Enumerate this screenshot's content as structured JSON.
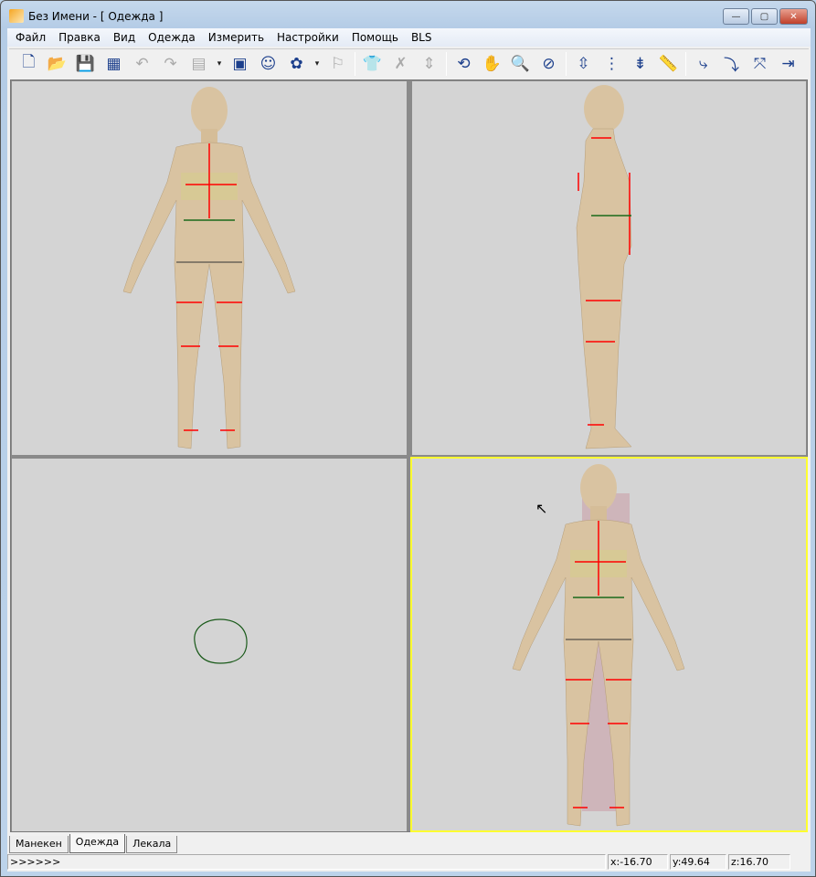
{
  "window": {
    "title": "Без Имени  - [  Одежда  ]",
    "minimize": "—",
    "maximize": "▢",
    "close": "✕"
  },
  "menu": [
    "Файл",
    "Правка",
    "Вид",
    "Одежда",
    "Измерить",
    "Настройки",
    "Помощь",
    "BLS"
  ],
  "toolbar": [
    {
      "name": "new-file-icon",
      "glyph": "🗋"
    },
    {
      "name": "open-folder-icon",
      "glyph": "📂"
    },
    {
      "name": "save-icon",
      "glyph": "💾"
    },
    {
      "name": "save-as-icon",
      "glyph": "▦"
    },
    {
      "name": "undo-icon",
      "glyph": "↶",
      "disabled": true
    },
    {
      "name": "redo-icon",
      "glyph": "↷",
      "disabled": true
    },
    {
      "name": "fabric-icon",
      "glyph": "▤",
      "disabled": true
    },
    {
      "name": "fabric-dropdown-icon",
      "glyph": "▾",
      "disabled": true,
      "small": true
    },
    {
      "name": "layout-icon",
      "glyph": "▣"
    },
    {
      "name": "mannequin-icon",
      "glyph": "☺"
    },
    {
      "name": "texture-icon",
      "glyph": "✿"
    },
    {
      "name": "texture-dropdown-icon",
      "glyph": "▾",
      "small": true
    },
    {
      "name": "flag-icon",
      "glyph": "⚐",
      "disabled": true
    },
    {
      "sep": true
    },
    {
      "name": "shirt-icon",
      "glyph": "👕"
    },
    {
      "name": "remove-garment-icon",
      "glyph": "✗",
      "disabled": true
    },
    {
      "name": "garment-size-icon",
      "glyph": "⇕",
      "disabled": true
    },
    {
      "sep": true
    },
    {
      "name": "rotate-icon",
      "glyph": "⟲"
    },
    {
      "name": "pan-hand-icon",
      "glyph": "✋"
    },
    {
      "name": "zoom-icon",
      "glyph": "🔍"
    },
    {
      "name": "view-fit-icon",
      "glyph": "⊘"
    },
    {
      "sep": true
    },
    {
      "name": "measure-vertical-icon",
      "glyph": "⇳"
    },
    {
      "name": "measure-dotted-icon",
      "glyph": "⋮"
    },
    {
      "name": "measure-multi-icon",
      "glyph": "⇟"
    },
    {
      "name": "ruler-icon",
      "glyph": "📏"
    },
    {
      "sep": true
    },
    {
      "name": "add-point-icon",
      "glyph": "⤷"
    },
    {
      "name": "remove-point-icon",
      "glyph": "⤵"
    },
    {
      "name": "move-point-icon",
      "glyph": "⤧"
    },
    {
      "name": "mirror-point-icon",
      "glyph": "⇥"
    }
  ],
  "tabs": [
    "Манекен",
    "Одежда",
    "Лекала"
  ],
  "status": {
    "command": ">>>>>>",
    "x": "x:-16.70",
    "y": "y:49.64",
    "z": "z:16.70"
  },
  "colors": {
    "skin": "#d9c3a1",
    "measure": "#ff0000",
    "active_border": "#ffff30",
    "contour": "#1a5a1a"
  }
}
